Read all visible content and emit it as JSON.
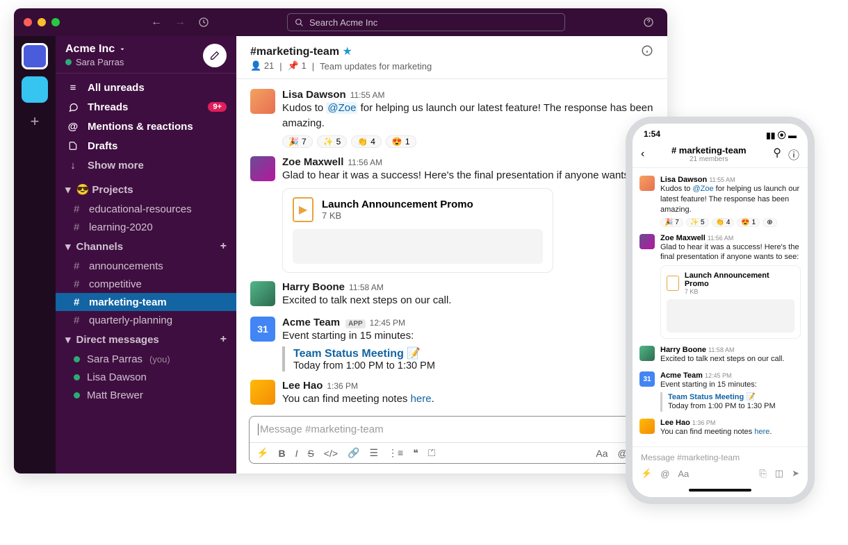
{
  "titlebar": {
    "search_placeholder": "Search Acme Inc"
  },
  "workspace": {
    "name": "Acme Inc",
    "user": "Sara Parras"
  },
  "nav": {
    "unreads": "All unreads",
    "threads": "Threads",
    "threads_badge": "9+",
    "mentions": "Mentions & reactions",
    "drafts": "Drafts",
    "show_more": "Show more"
  },
  "sections": {
    "projects": {
      "label": "😎 Projects",
      "items": [
        "educational-resources",
        "learning-2020"
      ]
    },
    "channels": {
      "label": "Channels",
      "items": [
        "announcements",
        "competitive",
        "marketing-team",
        "quarterly-planning"
      ],
      "active": "marketing-team"
    },
    "dms": {
      "label": "Direct messages",
      "items": [
        {
          "name": "Sara Parras",
          "you": "(you)"
        },
        {
          "name": "Lisa Dawson",
          "you": ""
        },
        {
          "name": "Matt Brewer",
          "you": ""
        }
      ]
    }
  },
  "channel": {
    "name": "#marketing-team",
    "members": "21",
    "pins": "1",
    "topic": "Team updates for marketing"
  },
  "messages": [
    {
      "sender": "Lisa Dawson",
      "time": "11:55 AM",
      "text_prefix": "Kudos to ",
      "mention": "@Zoe",
      "text_suffix": " for helping us launch our latest feature! The response has been amazing.",
      "reactions": [
        {
          "e": "🎉",
          "c": "7"
        },
        {
          "e": "✨",
          "c": "5"
        },
        {
          "e": "👏",
          "c": "4"
        },
        {
          "e": "😍",
          "c": "1"
        }
      ]
    },
    {
      "sender": "Zoe Maxwell",
      "time": "11:56 AM",
      "text": "Glad to hear it was a success! Here's the final presentation if anyone wants to see:",
      "file": {
        "name": "Launch Announcement Promo",
        "size": "7 KB"
      }
    },
    {
      "sender": "Harry Boone",
      "time": "11:58 AM",
      "text": "Excited to talk next steps on our call."
    },
    {
      "sender": "Acme Team",
      "app": "APP",
      "time": "12:45 PM",
      "text": "Event starting in 15 minutes:",
      "event": {
        "title": "Team Status Meeting",
        "emoji": "📝",
        "when": "Today from 1:00 PM to 1:30 PM"
      },
      "cal_day": "31"
    },
    {
      "sender": "Lee Hao",
      "time": "1:36 PM",
      "text_prefix": "You can find meeting notes ",
      "link": "here",
      "text_suffix": "."
    }
  ],
  "composer": {
    "placeholder": "Message #marketing-team"
  },
  "phone": {
    "time": "1:54",
    "channel": "# marketing-team",
    "members": "21 members",
    "composer": "Message #marketing-team"
  }
}
